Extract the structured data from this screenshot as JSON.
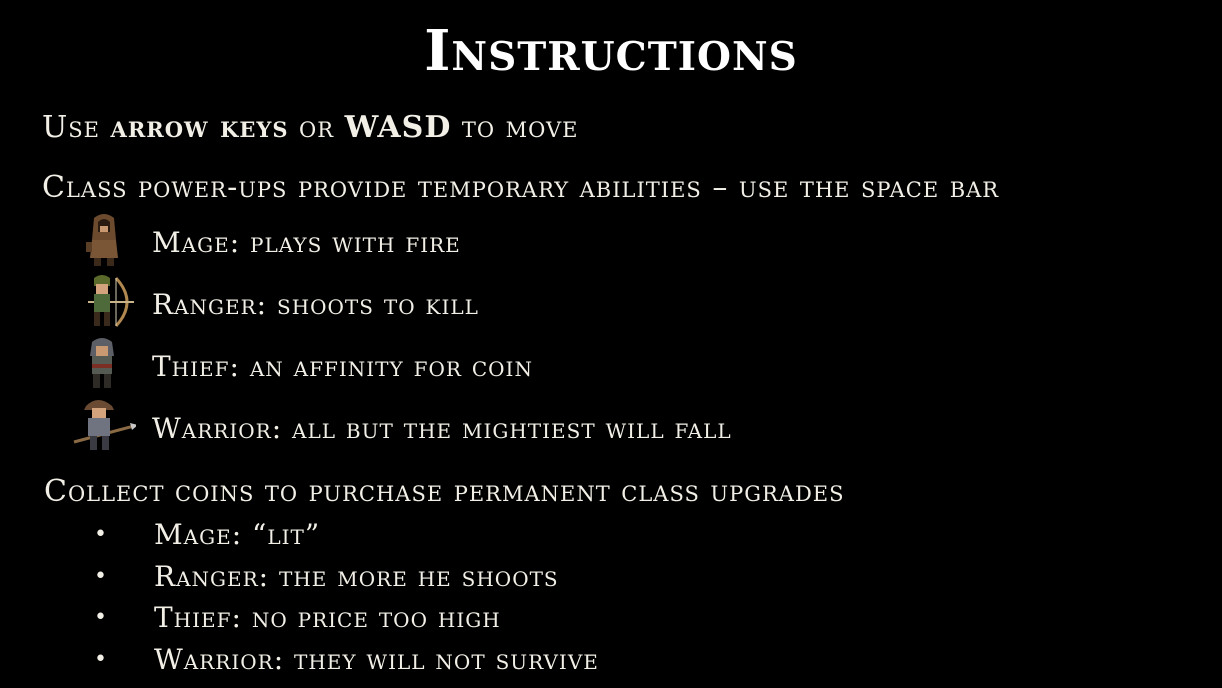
{
  "screen": {
    "title": "Instructions"
  },
  "movement": {
    "prefix": "Use",
    "arrow_keys": "arrow keys",
    "or": "or",
    "wasd": "WASD",
    "suffix": "to move"
  },
  "powerups": {
    "heading": "Class power-ups provide temporary abilities – use the space bar",
    "classes": [
      {
        "label": "Mage: plays with fire",
        "icon": "mage-sprite-icon"
      },
      {
        "label": "Ranger: shoots to kill",
        "icon": "ranger-sprite-icon"
      },
      {
        "label": "Thief: an affinity for coin",
        "icon": "thief-sprite-icon"
      },
      {
        "label": "Warrior: all but the mightiest will fall",
        "icon": "warrior-sprite-icon"
      }
    ]
  },
  "upgrades": {
    "heading": "Collect coins to purchase permanent class upgrades",
    "bullet": "•",
    "items": [
      "Mage: “lit”",
      "Ranger: the more he shoots",
      "Thief: no price too high",
      "Warrior: they will not survive"
    ]
  },
  "colors": {
    "background": "#000000",
    "text": "#f2efe6"
  }
}
